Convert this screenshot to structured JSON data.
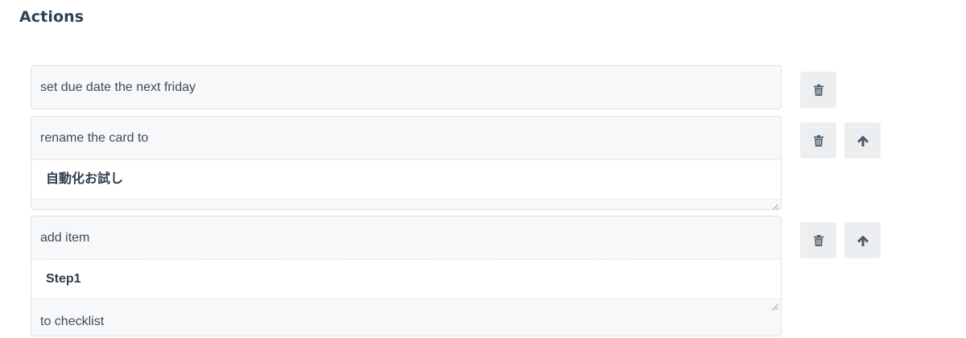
{
  "header": {
    "title": "Actions"
  },
  "actions": [
    {
      "text": "set due date the next friday",
      "buttons": [
        "trash-icon"
      ]
    },
    {
      "text": "rename the card to",
      "input_value": "自動化お試し",
      "buttons": [
        "trash-icon",
        "arrow-up-icon"
      ]
    },
    {
      "text": "add item",
      "input_value": "Step1",
      "text_after": "to checklist",
      "buttons": [
        "trash-icon",
        "arrow-up-icon"
      ]
    }
  ],
  "colors": {
    "card_background": "#f7f8f9",
    "card_border": "#dfe3e7",
    "button_background": "#eceef0",
    "icon_color": "#4a5a6a",
    "title_color": "#2f4254"
  }
}
